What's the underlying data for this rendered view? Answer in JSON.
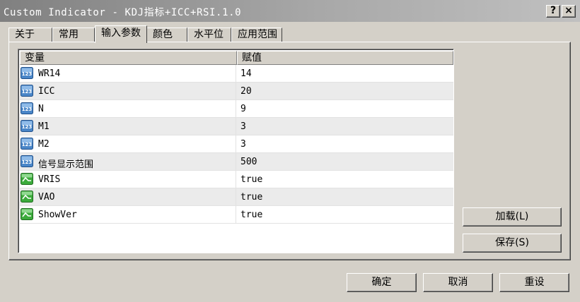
{
  "window": {
    "title": "Custom Indicator - KDJ指标+ICC+RSI.1.0",
    "help_button": "?",
    "close_button": "×"
  },
  "tabs": [
    {
      "label": "关于",
      "active": false
    },
    {
      "label": "常用",
      "active": false
    },
    {
      "label": "输入参数",
      "active": true
    },
    {
      "label": "颜色",
      "active": false
    },
    {
      "label": "水平位",
      "active": false
    },
    {
      "label": "应用范围",
      "active": false
    }
  ],
  "grid": {
    "columns": {
      "variable": "变量",
      "value": "赋值"
    },
    "rows": [
      {
        "icon": "numeric-123-icon",
        "name": "WR14",
        "value": "14"
      },
      {
        "icon": "numeric-123-icon",
        "name": "ICC",
        "value": "20"
      },
      {
        "icon": "numeric-123-icon",
        "name": "N",
        "value": "9"
      },
      {
        "icon": "numeric-123-icon",
        "name": "M1",
        "value": "3"
      },
      {
        "icon": "numeric-123-icon",
        "name": "M2",
        "value": "3"
      },
      {
        "icon": "numeric-123-icon",
        "name": "信号显示范围",
        "value": "500"
      },
      {
        "icon": "boolean-toggle-icon",
        "name": "VRIS",
        "value": "true"
      },
      {
        "icon": "boolean-toggle-icon",
        "name": "VAO",
        "value": "true"
      },
      {
        "icon": "boolean-toggle-icon",
        "name": "ShowVer",
        "value": "true"
      }
    ]
  },
  "side_buttons": {
    "load": "加载(L)",
    "save": "保存(S)"
  },
  "footer_buttons": {
    "ok": "确定",
    "cancel": "取消",
    "reset": "重设"
  },
  "colors": {
    "dialog_bg": "#d4d0c8",
    "numeric_icon": "#4a86c8",
    "boolean_icon": "#3cab3c",
    "row_alt": "#ebebeb"
  }
}
